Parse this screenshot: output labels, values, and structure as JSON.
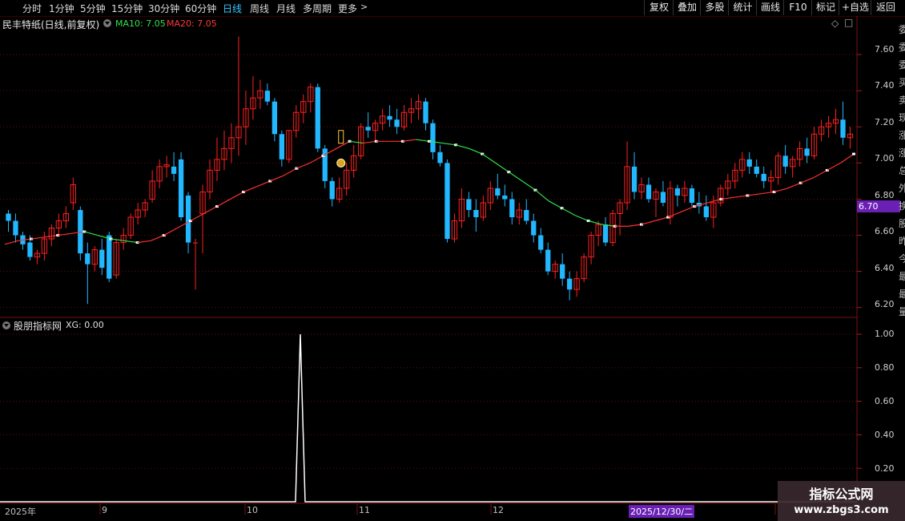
{
  "toolbar": {
    "periods": [
      "分时",
      "1分钟",
      "5分钟",
      "15分钟",
      "30分钟",
      "60分钟",
      "日线",
      "周线",
      "月线",
      "多周期",
      "更多"
    ],
    "active_period": "日线",
    "right_buttons": [
      "复权",
      "叠加",
      "多股",
      "统计",
      "画线",
      "F10",
      "标记",
      "+自选",
      "返回"
    ]
  },
  "main_chart": {
    "title": "民丰特纸(日线,前复权)",
    "ma10_label": "MA10: 7.05",
    "ma20_label": "MA20: 7.05",
    "price_ticks": [
      "7.60",
      "7.40",
      "7.20",
      "7.00",
      "6.80",
      "6.60",
      "6.40",
      "6.20"
    ],
    "current_price": "6.70"
  },
  "indicator": {
    "title": "股朋指标网",
    "value_label": "XG: 0.00",
    "ticks": [
      "1.00",
      "0.80",
      "0.60",
      "0.40",
      "0.20"
    ]
  },
  "x_axis": {
    "labels": [
      "2025年",
      "9",
      "10",
      "11",
      "12",
      "2025/12/30/二"
    ]
  },
  "side_text": [
    "委",
    "委",
    "委",
    "买",
    "卖",
    "现",
    "涨",
    "涨",
    "总",
    "外",
    "换",
    "股",
    "昨",
    "今",
    "最",
    "最",
    "量"
  ],
  "watermark": {
    "line1": "指标公式网",
    "line2": "www.zbgs3.com"
  },
  "colors": {
    "up": "#ff2020",
    "down": "#22b8ff",
    "ma10_up": "#ff3030",
    "ma10_down": "#2ee24a",
    "grid": "#5a1010",
    "price_tag_bg": "#6a1fb5"
  },
  "chart_data": {
    "type": "candlestick",
    "ylim": [
      6.15,
      7.8
    ],
    "candles": [
      {
        "o": 6.72,
        "h": 6.74,
        "l": 6.62,
        "c": 6.68
      },
      {
        "o": 6.68,
        "h": 6.72,
        "l": 6.56,
        "c": 6.6
      },
      {
        "o": 6.6,
        "h": 6.62,
        "l": 6.52,
        "c": 6.55
      },
      {
        "o": 6.56,
        "h": 6.6,
        "l": 6.46,
        "c": 6.48
      },
      {
        "o": 6.48,
        "h": 6.52,
        "l": 6.44,
        "c": 6.5
      },
      {
        "o": 6.5,
        "h": 6.62,
        "l": 6.46,
        "c": 6.58
      },
      {
        "o": 6.58,
        "h": 6.66,
        "l": 6.54,
        "c": 6.64
      },
      {
        "o": 6.64,
        "h": 6.72,
        "l": 6.6,
        "c": 6.68
      },
      {
        "o": 6.68,
        "h": 6.76,
        "l": 6.64,
        "c": 6.72
      },
      {
        "o": 6.78,
        "h": 6.92,
        "l": 6.74,
        "c": 6.88
      },
      {
        "o": 6.74,
        "h": 6.76,
        "l": 6.46,
        "c": 6.5
      },
      {
        "o": 6.5,
        "h": 6.56,
        "l": 6.22,
        "c": 6.44
      },
      {
        "o": 6.44,
        "h": 6.54,
        "l": 6.4,
        "c": 6.52
      },
      {
        "o": 6.52,
        "h": 6.58,
        "l": 6.38,
        "c": 6.42
      },
      {
        "o": 6.6,
        "h": 6.62,
        "l": 6.34,
        "c": 6.36
      },
      {
        "o": 6.38,
        "h": 6.58,
        "l": 6.36,
        "c": 6.56
      },
      {
        "o": 6.56,
        "h": 6.64,
        "l": 6.52,
        "c": 6.6
      },
      {
        "o": 6.6,
        "h": 6.72,
        "l": 6.58,
        "c": 6.7
      },
      {
        "o": 6.7,
        "h": 6.78,
        "l": 6.66,
        "c": 6.74
      },
      {
        "o": 6.74,
        "h": 6.8,
        "l": 6.7,
        "c": 6.78
      },
      {
        "o": 6.8,
        "h": 6.96,
        "l": 6.78,
        "c": 6.9
      },
      {
        "o": 6.9,
        "h": 7.02,
        "l": 6.86,
        "c": 6.98
      },
      {
        "o": 6.98,
        "h": 7.04,
        "l": 6.92,
        "c": 6.99
      },
      {
        "o": 6.98,
        "h": 7.06,
        "l": 6.9,
        "c": 6.94
      },
      {
        "o": 7.02,
        "h": 7.06,
        "l": 6.68,
        "c": 6.7
      },
      {
        "o": 6.82,
        "h": 6.84,
        "l": 6.5,
        "c": 6.56
      },
      {
        "o": 6.56,
        "h": 6.58,
        "l": 6.3,
        "c": 6.56
      },
      {
        "o": 6.72,
        "h": 6.88,
        "l": 6.5,
        "c": 6.84
      },
      {
        "o": 6.84,
        "h": 7.02,
        "l": 6.8,
        "c": 6.96
      },
      {
        "o": 6.96,
        "h": 7.14,
        "l": 6.9,
        "c": 7.02
      },
      {
        "o": 7.02,
        "h": 7.18,
        "l": 6.96,
        "c": 7.08
      },
      {
        "o": 7.08,
        "h": 7.22,
        "l": 7.0,
        "c": 7.14
      },
      {
        "o": 7.14,
        "h": 7.7,
        "l": 7.04,
        "c": 7.2
      },
      {
        "o": 7.2,
        "h": 7.4,
        "l": 7.1,
        "c": 7.3
      },
      {
        "o": 7.3,
        "h": 7.48,
        "l": 7.24,
        "c": 7.36
      },
      {
        "o": 7.36,
        "h": 7.46,
        "l": 7.3,
        "c": 7.4
      },
      {
        "o": 7.4,
        "h": 7.44,
        "l": 7.32,
        "c": 7.34
      },
      {
        "o": 7.34,
        "h": 7.36,
        "l": 7.12,
        "c": 7.16
      },
      {
        "o": 7.16,
        "h": 7.18,
        "l": 6.98,
        "c": 7.02
      },
      {
        "o": 7.02,
        "h": 7.18,
        "l": 7.0,
        "c": 7.18
      },
      {
        "o": 7.18,
        "h": 7.32,
        "l": 7.14,
        "c": 7.28
      },
      {
        "o": 7.28,
        "h": 7.38,
        "l": 7.22,
        "c": 7.34
      },
      {
        "o": 7.34,
        "h": 7.44,
        "l": 7.28,
        "c": 7.42
      },
      {
        "o": 7.42,
        "h": 7.44,
        "l": 7.06,
        "c": 7.08
      },
      {
        "o": 7.08,
        "h": 7.1,
        "l": 6.86,
        "c": 6.9
      },
      {
        "o": 6.9,
        "h": 6.92,
        "l": 6.76,
        "c": 6.8
      },
      {
        "o": 6.8,
        "h": 6.92,
        "l": 6.78,
        "c": 6.86
      },
      {
        "o": 6.86,
        "h": 7.0,
        "l": 6.82,
        "c": 6.96
      },
      {
        "o": 6.96,
        "h": 7.1,
        "l": 6.92,
        "c": 7.04
      },
      {
        "o": 7.04,
        "h": 7.22,
        "l": 7.02,
        "c": 7.2
      },
      {
        "o": 7.2,
        "h": 7.28,
        "l": 7.14,
        "c": 7.18
      },
      {
        "o": 7.18,
        "h": 7.24,
        "l": 7.12,
        "c": 7.22
      },
      {
        "o": 7.22,
        "h": 7.3,
        "l": 7.18,
        "c": 7.26
      },
      {
        "o": 7.26,
        "h": 7.32,
        "l": 7.2,
        "c": 7.24
      },
      {
        "o": 7.24,
        "h": 7.3,
        "l": 7.16,
        "c": 7.2
      },
      {
        "o": 7.2,
        "h": 7.32,
        "l": 7.18,
        "c": 7.28
      },
      {
        "o": 7.28,
        "h": 7.36,
        "l": 7.22,
        "c": 7.3
      },
      {
        "o": 7.3,
        "h": 7.38,
        "l": 7.24,
        "c": 7.34
      },
      {
        "o": 7.34,
        "h": 7.36,
        "l": 7.18,
        "c": 7.22
      },
      {
        "o": 7.22,
        "h": 7.24,
        "l": 7.02,
        "c": 7.06
      },
      {
        "o": 7.06,
        "h": 7.1,
        "l": 6.98,
        "c": 7.0
      },
      {
        "o": 7.0,
        "h": 7.02,
        "l": 6.56,
        "c": 6.58
      },
      {
        "o": 6.58,
        "h": 6.72,
        "l": 6.56,
        "c": 6.68
      },
      {
        "o": 6.68,
        "h": 6.86,
        "l": 6.64,
        "c": 6.8
      },
      {
        "o": 6.8,
        "h": 6.84,
        "l": 6.7,
        "c": 6.74
      },
      {
        "o": 6.74,
        "h": 6.8,
        "l": 6.62,
        "c": 6.7
      },
      {
        "o": 6.7,
        "h": 6.82,
        "l": 6.68,
        "c": 6.78
      },
      {
        "o": 6.78,
        "h": 6.9,
        "l": 6.74,
        "c": 6.86
      },
      {
        "o": 6.86,
        "h": 6.94,
        "l": 6.8,
        "c": 6.82
      },
      {
        "o": 6.82,
        "h": 6.88,
        "l": 6.76,
        "c": 6.8
      },
      {
        "o": 6.8,
        "h": 6.84,
        "l": 6.66,
        "c": 6.7
      },
      {
        "o": 6.7,
        "h": 6.78,
        "l": 6.66,
        "c": 6.74
      },
      {
        "o": 6.74,
        "h": 6.8,
        "l": 6.66,
        "c": 6.68
      },
      {
        "o": 6.68,
        "h": 6.72,
        "l": 6.56,
        "c": 6.6
      },
      {
        "o": 6.6,
        "h": 6.64,
        "l": 6.5,
        "c": 6.52
      },
      {
        "o": 6.52,
        "h": 6.56,
        "l": 6.38,
        "c": 6.4
      },
      {
        "o": 6.4,
        "h": 6.46,
        "l": 6.36,
        "c": 6.44
      },
      {
        "o": 6.44,
        "h": 6.5,
        "l": 6.32,
        "c": 6.36
      },
      {
        "o": 6.36,
        "h": 6.4,
        "l": 6.24,
        "c": 6.3
      },
      {
        "o": 6.3,
        "h": 6.4,
        "l": 6.26,
        "c": 6.36
      },
      {
        "o": 6.36,
        "h": 6.5,
        "l": 6.34,
        "c": 6.48
      },
      {
        "o": 6.48,
        "h": 6.62,
        "l": 6.44,
        "c": 6.6
      },
      {
        "o": 6.6,
        "h": 6.68,
        "l": 6.54,
        "c": 6.66
      },
      {
        "o": 6.66,
        "h": 6.7,
        "l": 6.54,
        "c": 6.56
      },
      {
        "o": 6.56,
        "h": 6.74,
        "l": 6.54,
        "c": 6.72
      },
      {
        "o": 6.72,
        "h": 6.8,
        "l": 6.6,
        "c": 6.78
      },
      {
        "o": 6.78,
        "h": 7.12,
        "l": 6.74,
        "c": 6.98
      },
      {
        "o": 6.98,
        "h": 7.06,
        "l": 6.8,
        "c": 6.84
      },
      {
        "o": 6.84,
        "h": 6.92,
        "l": 6.8,
        "c": 6.88
      },
      {
        "o": 6.88,
        "h": 6.92,
        "l": 6.78,
        "c": 6.8
      },
      {
        "o": 6.8,
        "h": 6.86,
        "l": 6.7,
        "c": 6.84
      },
      {
        "o": 6.84,
        "h": 6.9,
        "l": 6.76,
        "c": 6.78
      },
      {
        "o": 6.7,
        "h": 6.9,
        "l": 6.66,
        "c": 6.86
      },
      {
        "o": 6.86,
        "h": 6.88,
        "l": 6.76,
        "c": 6.82
      },
      {
        "o": 6.82,
        "h": 6.9,
        "l": 6.78,
        "c": 6.86
      },
      {
        "o": 6.86,
        "h": 6.88,
        "l": 6.76,
        "c": 6.78
      },
      {
        "o": 6.78,
        "h": 6.84,
        "l": 6.72,
        "c": 6.76
      },
      {
        "o": 6.76,
        "h": 6.82,
        "l": 6.68,
        "c": 6.7
      },
      {
        "o": 6.7,
        "h": 6.82,
        "l": 6.64,
        "c": 6.78
      },
      {
        "o": 6.78,
        "h": 6.88,
        "l": 6.76,
        "c": 6.86
      },
      {
        "o": 6.86,
        "h": 6.94,
        "l": 6.82,
        "c": 6.9
      },
      {
        "o": 6.9,
        "h": 7.0,
        "l": 6.86,
        "c": 6.96
      },
      {
        "o": 6.96,
        "h": 7.06,
        "l": 6.92,
        "c": 7.02
      },
      {
        "o": 7.02,
        "h": 7.06,
        "l": 6.94,
        "c": 6.98
      },
      {
        "o": 6.98,
        "h": 7.02,
        "l": 6.92,
        "c": 6.94
      },
      {
        "o": 6.94,
        "h": 6.98,
        "l": 6.86,
        "c": 6.9
      },
      {
        "o": 6.9,
        "h": 6.96,
        "l": 6.84,
        "c": 6.92
      },
      {
        "o": 6.92,
        "h": 7.06,
        "l": 6.88,
        "c": 7.04
      },
      {
        "o": 7.04,
        "h": 7.1,
        "l": 6.94,
        "c": 6.98
      },
      {
        "o": 6.98,
        "h": 7.04,
        "l": 6.92,
        "c": 7.02
      },
      {
        "o": 7.02,
        "h": 7.12,
        "l": 6.98,
        "c": 7.08
      },
      {
        "o": 7.08,
        "h": 7.14,
        "l": 7.0,
        "c": 7.04
      },
      {
        "o": 7.04,
        "h": 7.2,
        "l": 7.02,
        "c": 7.16
      },
      {
        "o": 7.16,
        "h": 7.24,
        "l": 7.12,
        "c": 7.2
      },
      {
        "o": 7.2,
        "h": 7.26,
        "l": 7.14,
        "c": 7.22
      },
      {
        "o": 7.22,
        "h": 7.3,
        "l": 7.16,
        "c": 7.24
      },
      {
        "o": 7.24,
        "h": 7.34,
        "l": 7.1,
        "c": 7.14
      },
      {
        "o": 7.14,
        "h": 7.2,
        "l": 7.08,
        "c": 7.16
      }
    ],
    "ma20": [
      6.55,
      6.57,
      6.58,
      6.59,
      6.6,
      6.61,
      6.62,
      6.6,
      6.58,
      6.57,
      6.56,
      6.57,
      6.6,
      6.64,
      6.68,
      6.72,
      6.76,
      6.8,
      6.84,
      6.87,
      6.9,
      6.93,
      6.97,
      7.0,
      7.04,
      7.08,
      7.12,
      7.11,
      7.12,
      7.12,
      7.12,
      7.13,
      7.12,
      7.11,
      7.1,
      7.08,
      7.05,
      7.0,
      6.95,
      6.9,
      6.85,
      6.79,
      6.75,
      6.71,
      6.68,
      6.66,
      6.65,
      6.65,
      6.66,
      6.68,
      6.7,
      6.73,
      6.76,
      6.78,
      6.8,
      6.81,
      6.82,
      6.83,
      6.84,
      6.86,
      6.89,
      6.92,
      6.96,
      7.0,
      7.05
    ],
    "signal_index": 44
  }
}
